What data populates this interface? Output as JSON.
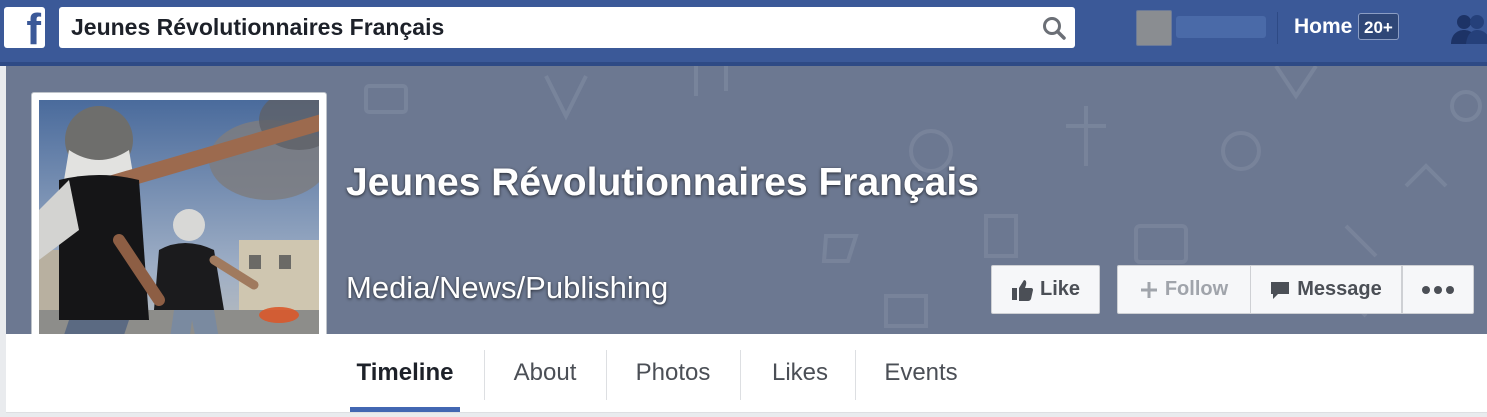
{
  "header": {
    "search_value": "Jeunes Révolutionnaires Français",
    "home_label": "Home",
    "notification_badge": "20+"
  },
  "page": {
    "title": "Jeunes Révolutionnaires Français",
    "category": "Media/News/Publishing"
  },
  "actions": {
    "like_label": "Like",
    "follow_label": "Follow",
    "message_label": "Message"
  },
  "tabs": [
    "Timeline",
    "About",
    "Photos",
    "Likes",
    "Events"
  ],
  "colors": {
    "brand_blue": "#3b5998",
    "cover_bg": "#6c7891",
    "active_tab_underline": "#4267b2"
  }
}
